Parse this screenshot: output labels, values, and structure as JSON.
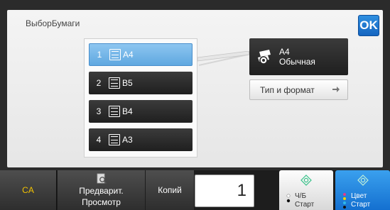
{
  "screen": {
    "title": "ВыборБумаги",
    "ok_label": "OK"
  },
  "trays": [
    {
      "number": "1",
      "size": "A4",
      "selected": true
    },
    {
      "number": "2",
      "size": "B5",
      "selected": false
    },
    {
      "number": "3",
      "size": "B4",
      "selected": false
    },
    {
      "number": "4",
      "size": "A3",
      "selected": false
    }
  ],
  "paper_info": {
    "size": "A4",
    "type": "Обычная"
  },
  "type_format_button": {
    "label": "Тип и формат"
  },
  "bottom_bar": {
    "ca_label": "CA",
    "preview_line1": "Предварит.",
    "preview_line2": "Просмотр",
    "copies_label": "Копий",
    "copies_value": "1",
    "bw_start_line1": "Ч/Б",
    "bw_start_line2": "Старт",
    "color_start_line1": "Цвет",
    "color_start_line2": "Старт"
  },
  "colors": {
    "accent": "#1565c0",
    "selected_tray": "#5fa8e0",
    "ca_text": "#f2c200",
    "start_green": "#39c28a"
  }
}
